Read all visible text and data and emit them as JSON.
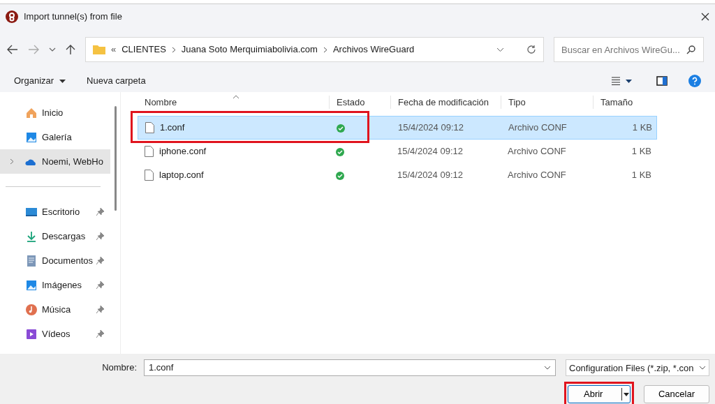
{
  "window": {
    "title": "Import tunnel(s) from file"
  },
  "address": {
    "overflow": "«",
    "crumbs": [
      "CLIENTES",
      "Juana Soto Merquimiabolivia.com",
      "Archivos WireGuard"
    ]
  },
  "search": {
    "placeholder": "Buscar en Archivos WireGu..."
  },
  "toolbar": {
    "buttons": [
      "Organizar",
      "Nueva carpeta"
    ]
  },
  "sidebar": {
    "items": [
      {
        "label": "Inicio",
        "kind": "home",
        "selected": false,
        "pinned": false
      },
      {
        "label": "Galería",
        "kind": "gallery",
        "selected": false,
        "pinned": false
      },
      {
        "label": "Noemi, WebHo",
        "kind": "cloud",
        "selected": true,
        "pinned": false
      },
      {
        "label": "Escritorio",
        "kind": "desktop",
        "selected": false,
        "pinned": true
      },
      {
        "label": "Descargas",
        "kind": "download",
        "selected": false,
        "pinned": true
      },
      {
        "label": "Documentos",
        "kind": "document",
        "selected": false,
        "pinned": true
      },
      {
        "label": "Imágenes",
        "kind": "pictures",
        "selected": false,
        "pinned": true
      },
      {
        "label": "Música",
        "kind": "music",
        "selected": false,
        "pinned": true
      },
      {
        "label": "Vídeos",
        "kind": "video",
        "selected": false,
        "pinned": true
      }
    ]
  },
  "table": {
    "columns": [
      "Nombre",
      "Estado",
      "Fecha de modificación",
      "Tipo",
      "Tamaño"
    ],
    "rows": [
      {
        "name": "1.conf",
        "synced": true,
        "modified": "15/4/2024 09:12",
        "type": "Archivo CONF",
        "size": "1 KB",
        "selected": true,
        "marked": true
      },
      {
        "name": "iphone.conf",
        "synced": true,
        "modified": "15/4/2024 09:12",
        "type": "Archivo CONF",
        "size": "1 KB",
        "selected": false,
        "marked": false
      },
      {
        "name": "laptop.conf",
        "synced": true,
        "modified": "15/4/2024 09:12",
        "type": "Archivo CONF",
        "size": "1 KB",
        "selected": false,
        "marked": false
      }
    ]
  },
  "footer": {
    "name_label": "Nombre:",
    "name_value": "1.conf",
    "filter": "Configuration Files (*.zip, *.con",
    "open_button": {
      "label": "Abrir",
      "marked": true
    },
    "cancel_button": "Cancelar"
  }
}
